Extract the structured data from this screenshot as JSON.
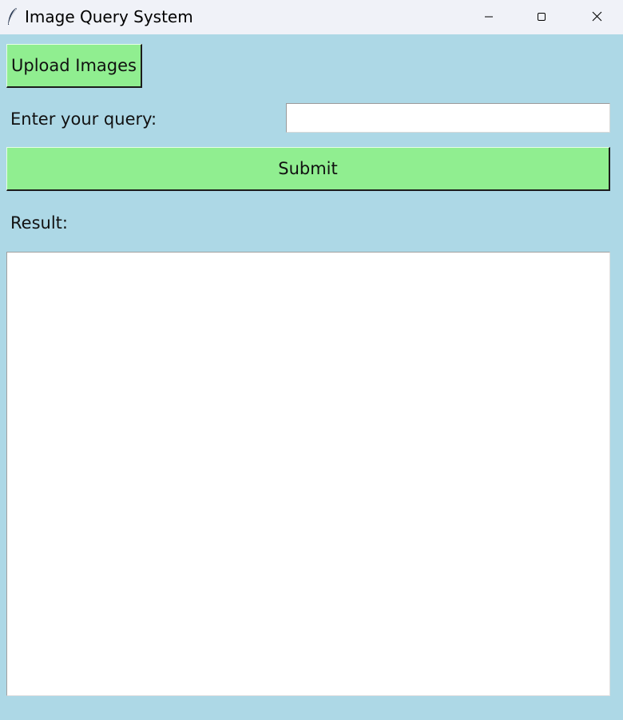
{
  "window": {
    "title": "Image Query System",
    "controls": {
      "minimize_icon": "minimize-icon",
      "maximize_icon": "maximize-icon",
      "close_icon": "close-icon"
    },
    "app_icon": "feather-icon"
  },
  "main": {
    "upload_button_label": "Upload Images",
    "query_label": "Enter your query:",
    "query_input_value": "",
    "submit_button_label": "Submit",
    "result_label": "Result:",
    "result_text": ""
  },
  "colors": {
    "background": "#add8e6",
    "button": "#90ee90",
    "titlebar": "#f0f2f8",
    "field": "#ffffff"
  }
}
